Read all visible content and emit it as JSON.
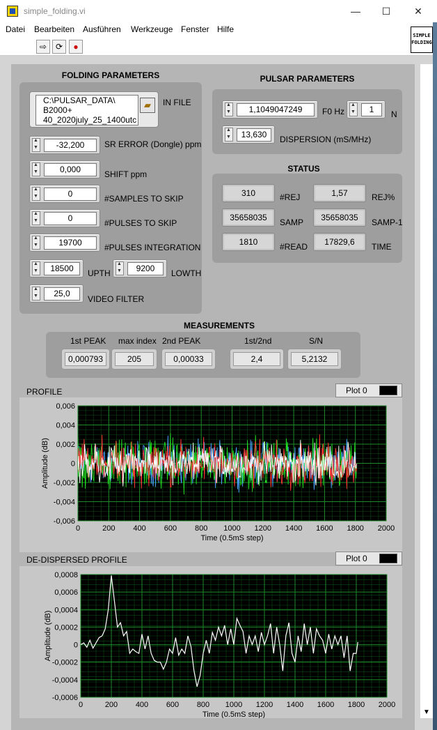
{
  "window": {
    "title": "simple_folding.vi",
    "minimize_glyph": "—",
    "maximize_glyph": "☐",
    "close_glyph": "✕"
  },
  "menu": [
    "Datei",
    "Bearbeiten",
    "Ausführen",
    "Werkzeuge",
    "Fenster",
    "Hilfe"
  ],
  "toolbar": {
    "run_glyph": "⇨",
    "run_continuous_glyph": "⟳",
    "abort_glyph": "●",
    "vi_icon_lines": [
      "SIMPLE",
      "FOLDING"
    ]
  },
  "folding": {
    "title": "FOLDING PARAMETERS",
    "in_file": {
      "label": "IN FILE",
      "lines": [
        "C:\\PULSAR_DATA\\",
        "B2000+",
        "40_2020july_25_1400utc"
      ],
      "browse_icon": "folder-icon"
    },
    "sr_error": {
      "label": "SR ERROR (Dongle) ppm",
      "value": "-32,200"
    },
    "shift": {
      "label": "SHIFT ppm",
      "value": "0,000"
    },
    "samples_skip": {
      "label": "#SAMPLES TO SKIP",
      "value": "0"
    },
    "pulses_skip": {
      "label": "#PULSES TO SKIP",
      "value": "0"
    },
    "pulses_integration": {
      "label": "#PULSES INTEGRATION",
      "value": "19700"
    },
    "upth": {
      "label": "UPTH",
      "value": "18500"
    },
    "lowth": {
      "label": "LOWTH",
      "value": "9200"
    },
    "video_filter": {
      "label": "VIDEO FILTER",
      "value": "25,0"
    }
  },
  "pulsar": {
    "title": "PULSAR PARAMETERS",
    "f0": {
      "label": "F0 Hz",
      "value": "1,1049047249"
    },
    "n": {
      "label": "N",
      "value": "1"
    },
    "dispersion": {
      "label": "DISPERSION (mS/MHz)",
      "value": "13,630"
    }
  },
  "status": {
    "title": "STATUS",
    "rej": {
      "label": "#REJ",
      "value": "310"
    },
    "rej_pct": {
      "label": "REJ%",
      "value": "1,57"
    },
    "samp": {
      "label": "SAMP",
      "value": "35658035"
    },
    "samp_1": {
      "label": "SAMP-1",
      "value": "35658035"
    },
    "read": {
      "label": "#READ",
      "value": "1810"
    },
    "time": {
      "label": "TIME",
      "value": "17829,6"
    }
  },
  "measurements": {
    "title": "MEASUREMENTS",
    "first_peak": {
      "label": "1st PEAK",
      "value": "0,000793"
    },
    "max_index": {
      "label": "max index",
      "value": "205"
    },
    "second_peak": {
      "label": "2nd PEAK",
      "value": "0,00033"
    },
    "ratio": {
      "label": "1st/2nd",
      "value": "2,4"
    },
    "sn": {
      "label": "S/N",
      "value": "5,2132"
    }
  },
  "profile_graph": {
    "title": "PROFILE",
    "legend": "Plot 0",
    "chart_data": {
      "type": "line",
      "title": "",
      "xlabel": "Time (0.5mS step)",
      "ylabel": "Amplitude (dB)",
      "xlim": [
        0,
        2000
      ],
      "ylim": [
        -0.006,
        0.006
      ],
      "x_ticks": [
        0,
        200,
        400,
        600,
        800,
        1000,
        1200,
        1400,
        1600,
        1800,
        2000
      ],
      "y_ticks": [
        -0.006,
        -0.004,
        -0.002,
        0,
        0.002,
        0.004,
        0.006
      ],
      "x_tick_labels": [
        "0",
        "200",
        "400",
        "600",
        "800",
        "1000",
        "1200",
        "1400",
        "1600",
        "1800",
        "2000"
      ],
      "y_tick_labels": [
        "-0,006",
        "-0,004",
        "-0,002",
        "0",
        "0,002",
        "0,004",
        "0,006"
      ],
      "grid": true,
      "series": [
        {
          "color": "#4aa0ff",
          "amp": 0.0023,
          "x": [
            0,
            1810
          ]
        },
        {
          "color": "#22dd22",
          "amp": 0.0026,
          "x": [
            0,
            1810
          ]
        },
        {
          "color": "#ff3333",
          "amp": 0.0024,
          "x": [
            0,
            1810
          ]
        },
        {
          "color": "#ffffff",
          "amp": 0.002,
          "x": [
            0,
            1810
          ]
        }
      ]
    }
  },
  "dedispersed_graph": {
    "title": "DE-DISPERSED PROFILE",
    "legend": "Plot 0",
    "chart_data": {
      "type": "line",
      "title": "",
      "xlabel": "Time (0.5mS step)",
      "ylabel": "Amplitude (dB)",
      "xlim": [
        0,
        2000
      ],
      "ylim": [
        -0.0006,
        0.0008
      ],
      "x_ticks": [
        0,
        200,
        400,
        600,
        800,
        1000,
        1200,
        1400,
        1600,
        1800,
        2000
      ],
      "y_ticks": [
        -0.0006,
        -0.0004,
        -0.0002,
        0,
        0.0002,
        0.0004,
        0.0006,
        0.0008
      ],
      "x_tick_labels": [
        "0",
        "200",
        "400",
        "600",
        "800",
        "1000",
        "1200",
        "1400",
        "1600",
        "1800",
        "2000"
      ],
      "y_tick_labels": [
        "-0,0006",
        "-0,0004",
        "-0,0002",
        "0",
        "0,0002",
        "0,0004",
        "0,0006",
        "0,0008"
      ],
      "grid": true,
      "series": [
        {
          "color": "#ffffff",
          "x": [
            0,
            20,
            40,
            60,
            80,
            100,
            120,
            140,
            160,
            180,
            200,
            220,
            240,
            260,
            280,
            300,
            320,
            340,
            360,
            380,
            400,
            420,
            440,
            460,
            480,
            500,
            520,
            540,
            560,
            580,
            600,
            620,
            640,
            660,
            680,
            700,
            720,
            740,
            760,
            780,
            800,
            820,
            840,
            860,
            880,
            900,
            920,
            940,
            960,
            980,
            1000,
            1020,
            1040,
            1060,
            1080,
            1100,
            1120,
            1140,
            1160,
            1180,
            1200,
            1220,
            1240,
            1260,
            1280,
            1300,
            1320,
            1340,
            1360,
            1380,
            1400,
            1420,
            1440,
            1460,
            1480,
            1500,
            1520,
            1540,
            1560,
            1580,
            1600,
            1620,
            1640,
            1660,
            1680,
            1700,
            1720,
            1740,
            1760,
            1780,
            1800,
            1810
          ],
          "y": [
            0,
            2e-05,
            -3e-05,
            5e-05,
            -4e-05,
            2e-05,
            8e-05,
            0.0001,
            0.00018,
            0.0004,
            0.00079,
            0.0005,
            0.0002,
            0.00025,
            0.0001,
            0.00015,
            -0.0001,
            -5e-05,
            -8e-05,
            -0.0001,
            0.00012,
            -5e-05,
            0.0001,
            -0.0001,
            -0.00018,
            -0.0002,
            -0.0002,
            -0.00028,
            -0.0002,
            -5e-05,
            -0.0001,
            8e-05,
            -0.00012,
            -5e-05,
            -0.0001,
            0.0001,
            -2e-05,
            -0.0003,
            -0.00048,
            -0.00035,
            -0.0001,
            5e-05,
            -0.0001,
            0.00014,
            5e-05,
            0.0002,
            0.0001,
            0.00022,
            0.0,
            0.00018,
            0.0,
            0.0003,
            0.00022,
            0.00015,
            -0.0001,
            0.0001,
            0.0,
            0.0001,
            -8e-05,
            0.00014,
            0.0,
            0.0001,
            0.00024,
            -0.0001,
            0.0002,
            0.0,
            -0.0003,
            0.0001,
            0.00025,
            -0.0001,
            -0.0002,
            0.0001,
            -8e-05,
            0.00024,
            0.0,
            0.0002,
            -0.0001,
            0.00018,
            0.0001,
            5e-05,
            -0.0001,
            0.00012,
            -5e-05,
            0.0001,
            0.0,
            0.0001,
            -0.00015,
            0.0001,
            -0.0003,
            -0.0001,
            -0.0001,
            3e-05
          ]
        }
      ]
    }
  }
}
